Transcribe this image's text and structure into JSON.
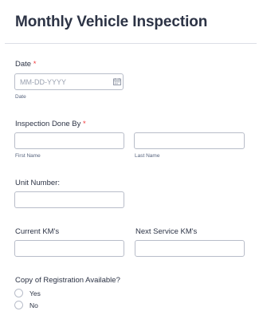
{
  "form": {
    "title": "Monthly Vehicle Inspection"
  },
  "date_field": {
    "label": "Date",
    "required_mark": "*",
    "placeholder": "MM-DD-YYYY",
    "sublabel": "Date",
    "icon": "calendar-icon"
  },
  "inspector_field": {
    "label": "Inspection Done By",
    "required_mark": "*",
    "first_sublabel": "First Name",
    "last_sublabel": "Last Name"
  },
  "unit_field": {
    "label": "Unit Number:"
  },
  "current_km_field": {
    "label": "Current KM's"
  },
  "next_service_field": {
    "label": "Next Service KM's"
  },
  "registration_field": {
    "label": "Copy of Registration Available?",
    "options": [
      "Yes",
      "No"
    ]
  }
}
